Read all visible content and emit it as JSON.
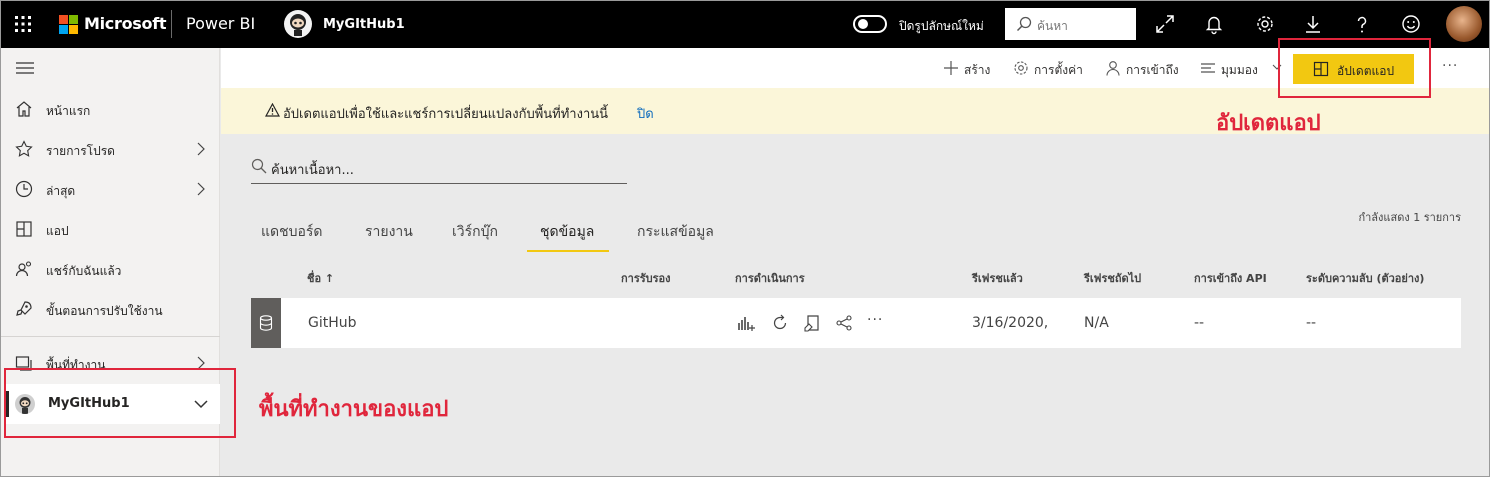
{
  "topbar": {
    "brand": "Microsoft",
    "product": "Power BI",
    "workspace": "MyGItHub1",
    "toggle_label": "ปิดรูปลักษณ์ใหม่",
    "search_placeholder": "ค้นหา"
  },
  "sidebar": {
    "items": [
      {
        "label": "หน้าแรก",
        "icon": "home-icon",
        "chevron": false
      },
      {
        "label": "รายการโปรด",
        "icon": "star-icon",
        "chevron": true
      },
      {
        "label": "ล่าสุด",
        "icon": "clock-icon",
        "chevron": true
      },
      {
        "label": "แอป",
        "icon": "apps-icon",
        "chevron": false
      },
      {
        "label": "แชร์กับฉันแล้ว",
        "icon": "shared-icon",
        "chevron": false
      },
      {
        "label": "ขั้นตอนการปรับใช้งาน",
        "icon": "rocket-icon",
        "chevron": false
      },
      {
        "label": "พื้นที่ทำงาน",
        "icon": "workspaces-icon",
        "chevron": true
      }
    ],
    "selected_workspace": "MyGItHub1"
  },
  "actionbar": {
    "create": "สร้าง",
    "settings": "การตั้งค่า",
    "access": "การเข้าถึง",
    "view": "มุมมอง",
    "update_app": "อัปเดตแอป",
    "more": "···"
  },
  "banner": {
    "text": "อัปเดตแอปเพื่อใช้และแชร์การเปลี่ยนแปลงกับพื้นที่ทำงานนี้",
    "close_link": "ปิด"
  },
  "content": {
    "search_placeholder": "ค้นหาเนื้อหา...",
    "showing": "กำลังแสดง 1 รายการ",
    "tabs": [
      "แดชบอร์ด",
      "รายงาน",
      "เวิร์กบุ๊ก",
      "ชุดข้อมูล",
      "กระแสข้อมูล"
    ],
    "active_tab": "ชุดข้อมูล",
    "columns": {
      "name": "ชื่อ ↑",
      "endorsement": "การรับรอง",
      "actions": "การดำเนินการ",
      "refreshed": "รีเฟรชแล้ว",
      "next_refresh": "รีเฟรชถัดไป",
      "api_access": "การเข้าถึง API",
      "sensitivity": "ระดับความลับ (ตัวอย่าง)"
    },
    "rows": [
      {
        "name": "GitHub",
        "refreshed": "3/16/2020,",
        "next_refresh": "N/A",
        "api_access": "--",
        "sensitivity": "--"
      }
    ]
  },
  "annotations": {
    "update_app": "อัปเดตแอป",
    "app_workspace": "พื้นที่ทำงานของแอป"
  },
  "colors": {
    "accent": "#f2c811",
    "annotation": "#e0263c",
    "banner": "#fbf6d9",
    "link": "#0f6cbd"
  }
}
